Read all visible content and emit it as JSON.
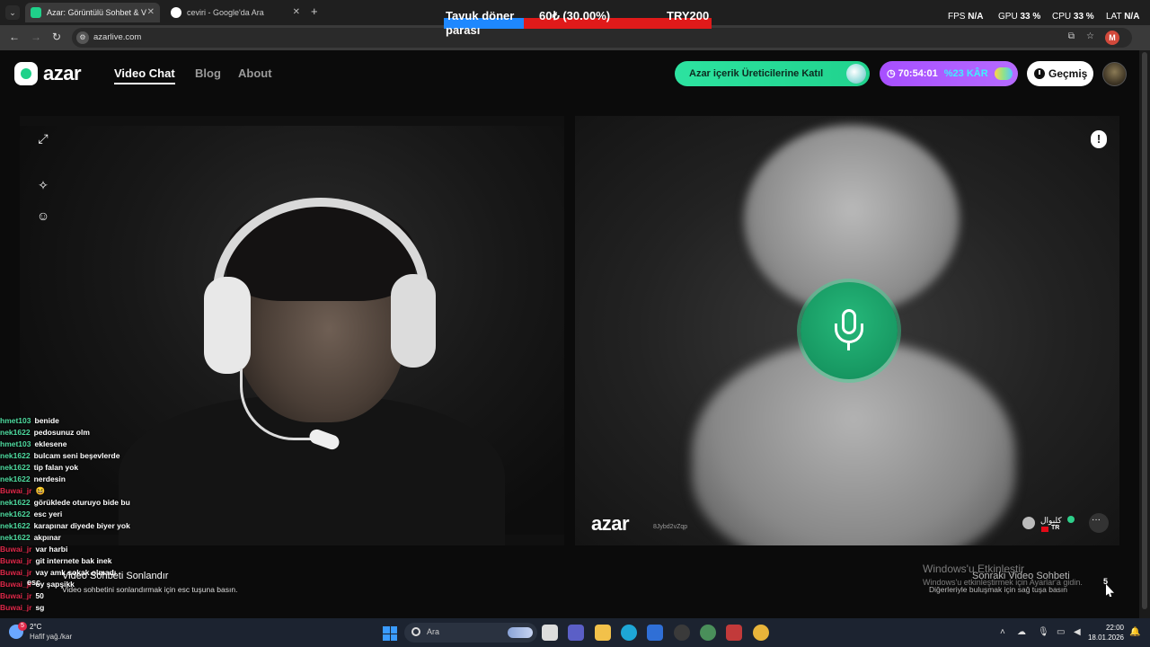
{
  "browser": {
    "tabs": [
      {
        "title": "Azar: Görüntülü Sohbet & V",
        "active": true
      },
      {
        "title": "ceviri - Google'da Ara",
        "active": false
      }
    ],
    "url": "azarlive.com",
    "profile_initial": "M"
  },
  "stream_overlay": {
    "goal_name": "Tavuk döner parası",
    "goal_amount": "60₺ (30.00%)",
    "goal_target": "TRY200",
    "goal_progress_percent": 30,
    "fps_label": "FPS",
    "fps_value": "N/A",
    "gpu_label": "GPU",
    "gpu_value": "33 %",
    "cpu_label": "CPU",
    "cpu_value": "33 %",
    "lat_label": "LAT",
    "lat_value": "N/A"
  },
  "header": {
    "logo_text": "azar",
    "nav": {
      "video_chat": "Video Chat",
      "blog": "Blog",
      "about": "About"
    },
    "cta_label": "Azar içerik Üreticilerine Katıl",
    "promo_timer": "70:54:01",
    "promo_discount": "%23 KÂR",
    "history_label": "Geçmiş"
  },
  "right_video": {
    "logo_text": "azar",
    "session_id": "8Jybd2vZqp",
    "peer_name": "كلبوال",
    "peer_country": "TR"
  },
  "chat": [
    {
      "user": "hmet103",
      "msg": "benide",
      "red": false
    },
    {
      "user": "nek1622",
      "msg": "pedosunuz olm",
      "red": false
    },
    {
      "user": "hmet103",
      "msg": "eklesene",
      "red": false
    },
    {
      "user": "nek1622",
      "msg": "bulcam seni beşevlerde",
      "red": false
    },
    {
      "user": "nek1622",
      "msg": "tip falan yok",
      "red": false
    },
    {
      "user": "nek1622",
      "msg": "nerdesin",
      "red": false
    },
    {
      "user": "Buwai_jr",
      "msg": "😆",
      "red": true
    },
    {
      "user": "nek1622",
      "msg": "görüklede oturuyo bide bu",
      "red": false
    },
    {
      "user": "nek1622",
      "msg": "esc yeri",
      "red": false
    },
    {
      "user": "nek1622",
      "msg": "karapınar diyede biyer yok",
      "red": false
    },
    {
      "user": "nek1622",
      "msg": "akpınar",
      "red": false
    },
    {
      "user": "Buwai_jr",
      "msg": "var harbi",
      "red": true
    },
    {
      "user": "Buwai_jr",
      "msg": "git internete bak inek",
      "red": true
    },
    {
      "user": "Buwai_jr",
      "msg": "vay amk sokak olmadı",
      "red": true
    },
    {
      "user": "Buwai_jr",
      "msg": "oy şapşikk",
      "red": true
    },
    {
      "user": "Buwai_jr",
      "msg": "50",
      "red": true
    },
    {
      "user": "Buwai_jr",
      "msg": "sg",
      "red": true
    }
  ],
  "hints": {
    "esc_key": "esc",
    "end_title": "Video Sohbeti Sonlandır",
    "end_sub": "Video sohbetini sonlandırmak için esc tuşuna basın.",
    "next_title": "Sonraki Video Sohbeti",
    "next_sub": "Diğerleriyle buluşmak için sağ tuşa basın",
    "next_key": "5",
    "windows_activate": "Windows'u Etkinleştir",
    "windows_activate_sub": "Windows'u etkinleştirmek için Ayarlar'a gidin."
  },
  "taskbar": {
    "weather_badge": "5",
    "weather_temp": "2°C",
    "weather_desc": "Hafif yağ./kar",
    "search_placeholder": "Ara",
    "time": "22:00",
    "date": "18.01.2026"
  }
}
